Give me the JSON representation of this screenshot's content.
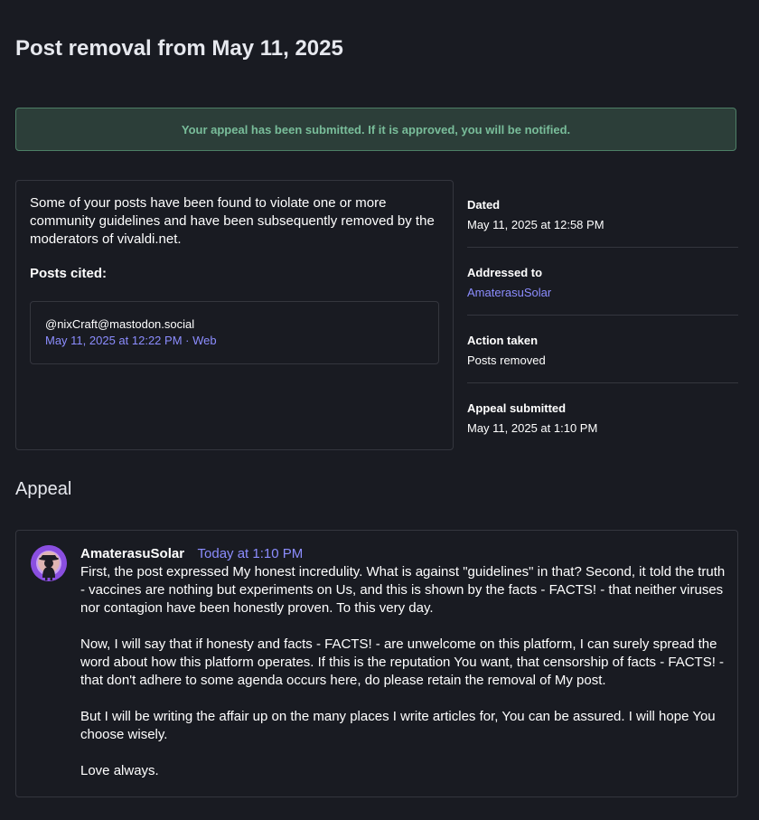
{
  "page": {
    "title": "Post removal from May 11, 2025"
  },
  "flash": {
    "message": "Your appeal has been submitted. If it is approved, you will be notified."
  },
  "strike": {
    "text": "Some of your posts have been found to violate one or more community guidelines and have been subsequently removed by the moderators of vivaldi.net.",
    "posts_cited_label": "Posts cited:",
    "cited_post": {
      "account": "@nixCraft@mastodon.social",
      "date": "May 11, 2025 at 12:22 PM",
      "separator": " · ",
      "application": "Web"
    }
  },
  "meta": {
    "dated_label": "Dated",
    "dated_value": "May 11, 2025 at 12:58 PM",
    "addressed_label": "Addressed to",
    "addressed_value": "AmaterasuSolar",
    "action_label": "Action taken",
    "action_value": "Posts removed",
    "appeal_label": "Appeal submitted",
    "appeal_value": "May 11, 2025 at 1:10 PM"
  },
  "appeal": {
    "section_title": "Appeal",
    "author": "AmaterasuSolar",
    "time": "Today at 1:10 PM",
    "avatar_icon": "avatar-icon",
    "paragraphs": [
      "First, the post expressed My honest incredulity.  What is against \"guidelines\" in that?  Second, it told the truth - vaccines are nothing but experiments on Us, and this is shown by the facts - FACTS! - that neither viruses nor contagion have been honestly proven.  To this very day.",
      "Now, I will say that if honesty and facts - FACTS! - are unwelcome on this platform, I can surely spread the word about how this platform operates.  If this is the reputation You want, that censorship of facts - FACTS! - that don't adhere to some agenda occurs here, do please retain the removal of My post.",
      "But I will be writing the affair up on the many places I write articles for, You can be assured.  I will hope You choose wisely.",
      "Love always."
    ]
  },
  "colors": {
    "background": "#191b22",
    "accent_link": "#8c8dff",
    "success_text": "#79bd9a",
    "success_bg": "#2c3e39",
    "border": "#34363e"
  }
}
